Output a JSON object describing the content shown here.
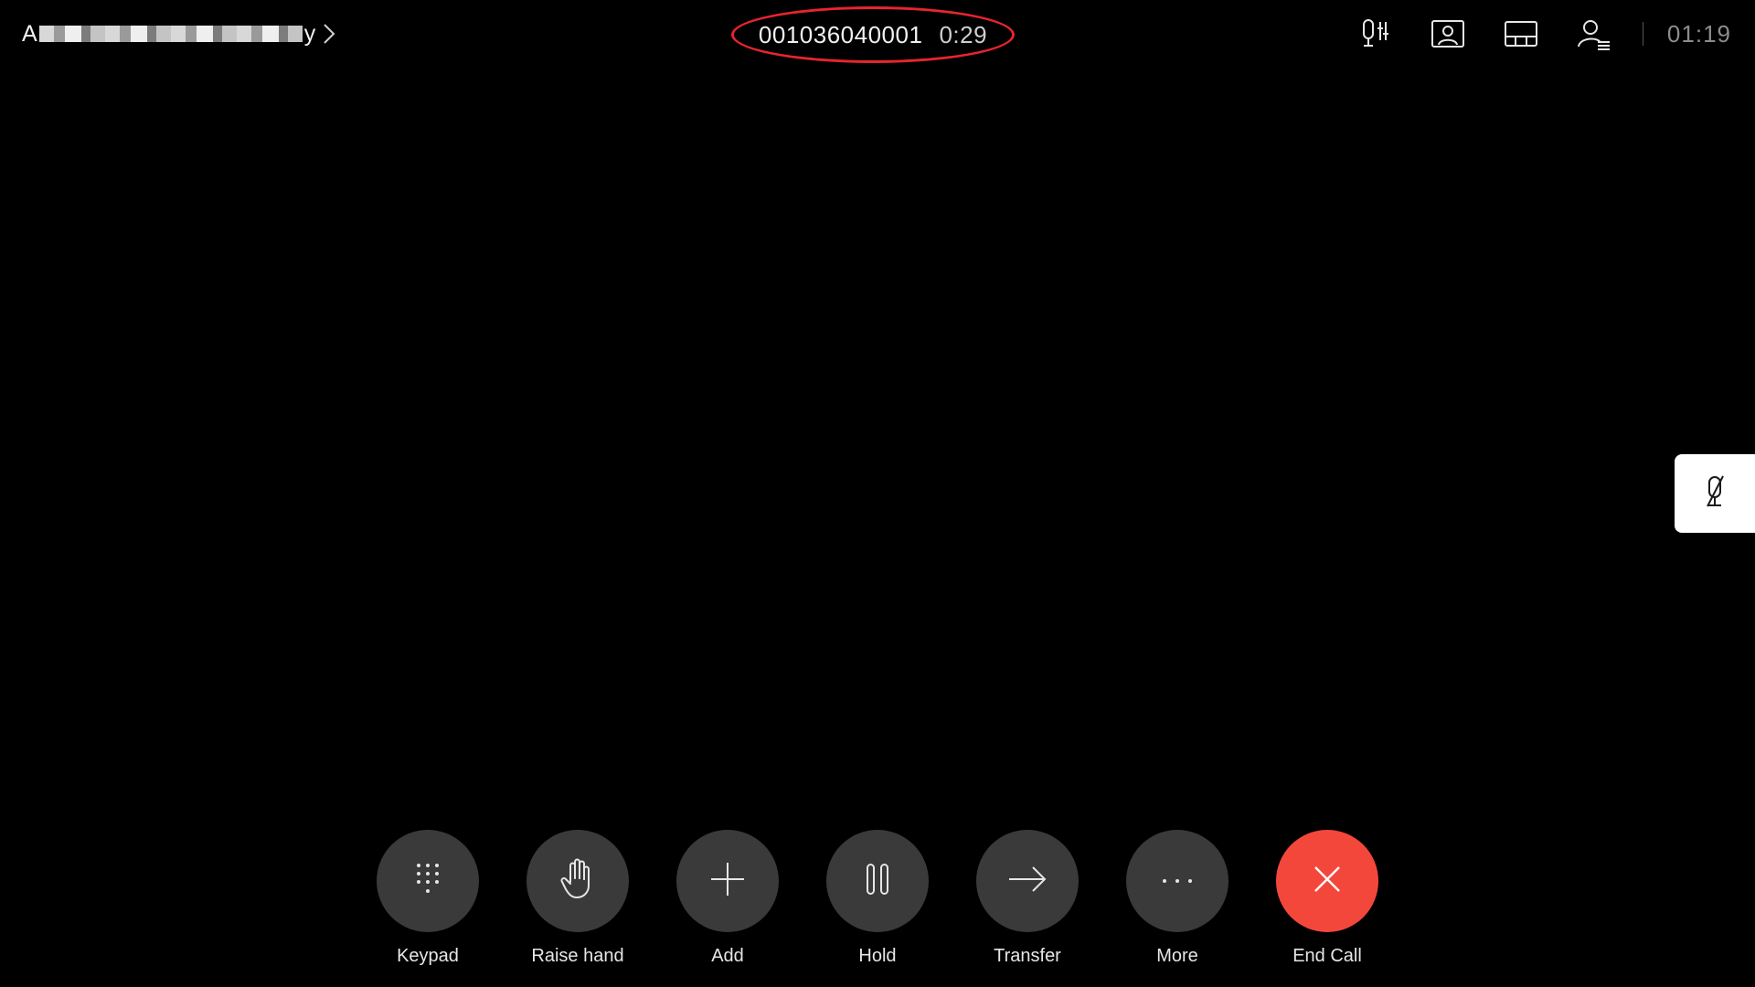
{
  "header": {
    "meeting_name_first": "A",
    "meeting_name_last": "y",
    "call_number": "001036040001",
    "call_timer": "0:29",
    "clock": "01:19",
    "icons": [
      "mic-settings-icon",
      "self-view-icon",
      "layout-icon",
      "participants-icon"
    ]
  },
  "side_tab": {
    "icon": "mic-muted-icon"
  },
  "controls": {
    "keypad": "Keypad",
    "raise_hand": "Raise hand",
    "add": "Add",
    "hold": "Hold",
    "transfer": "Transfer",
    "more": "More",
    "end_call": "End Call"
  },
  "colors": {
    "background": "#000000",
    "control_bg": "#3a3a3a",
    "end_call": "#f4473c",
    "highlight_ring": "#e8242f"
  }
}
